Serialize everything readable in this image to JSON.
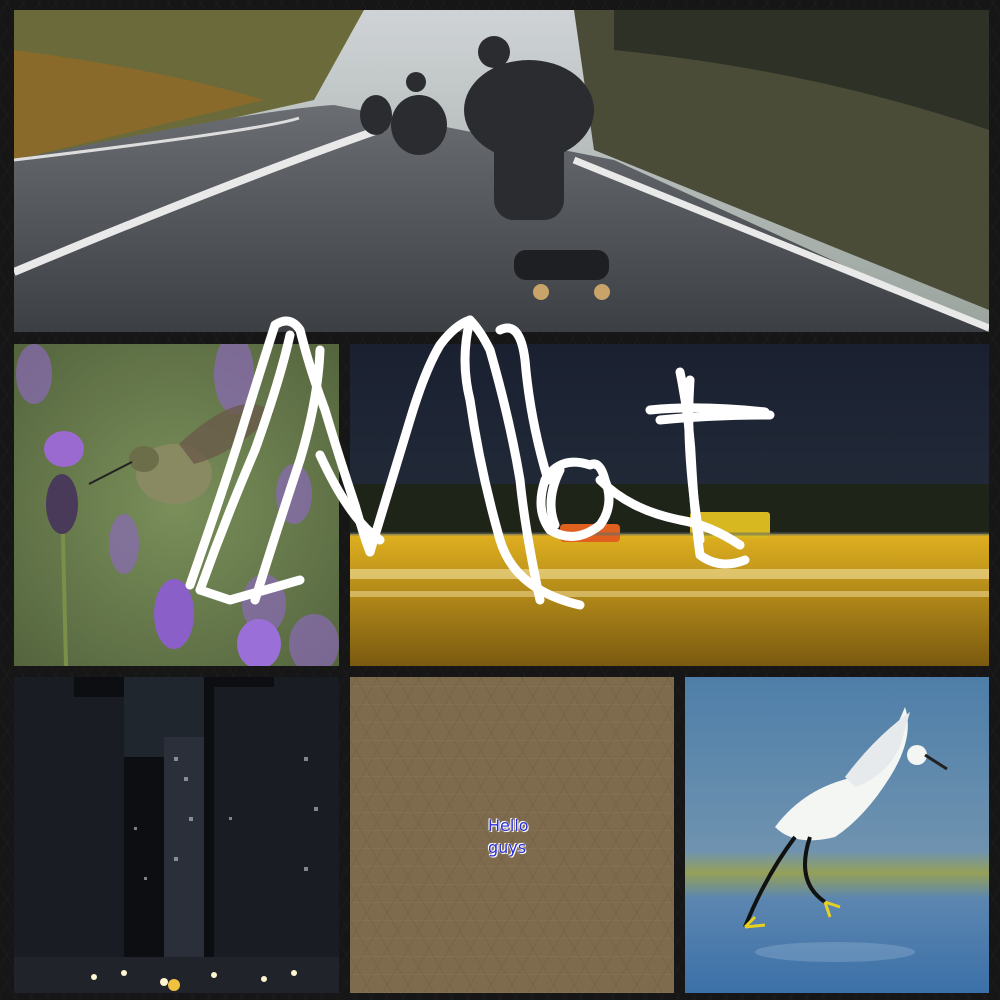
{
  "text_tile": {
    "lines": [
      "Hello",
      "guys"
    ]
  },
  "colors": {
    "background": "#161616",
    "text_tile_bg": "#7e6a4c",
    "text_color": "#2a2fd6",
    "scribble": "#ffffff"
  },
  "tiles": [
    {
      "name": "skateboarders-photo"
    },
    {
      "name": "hummingbird-lavender-photo"
    },
    {
      "name": "night-street-blur-photo"
    },
    {
      "name": "city-night-photo"
    },
    {
      "name": "hello-text-tile"
    },
    {
      "name": "egret-photo"
    }
  ]
}
